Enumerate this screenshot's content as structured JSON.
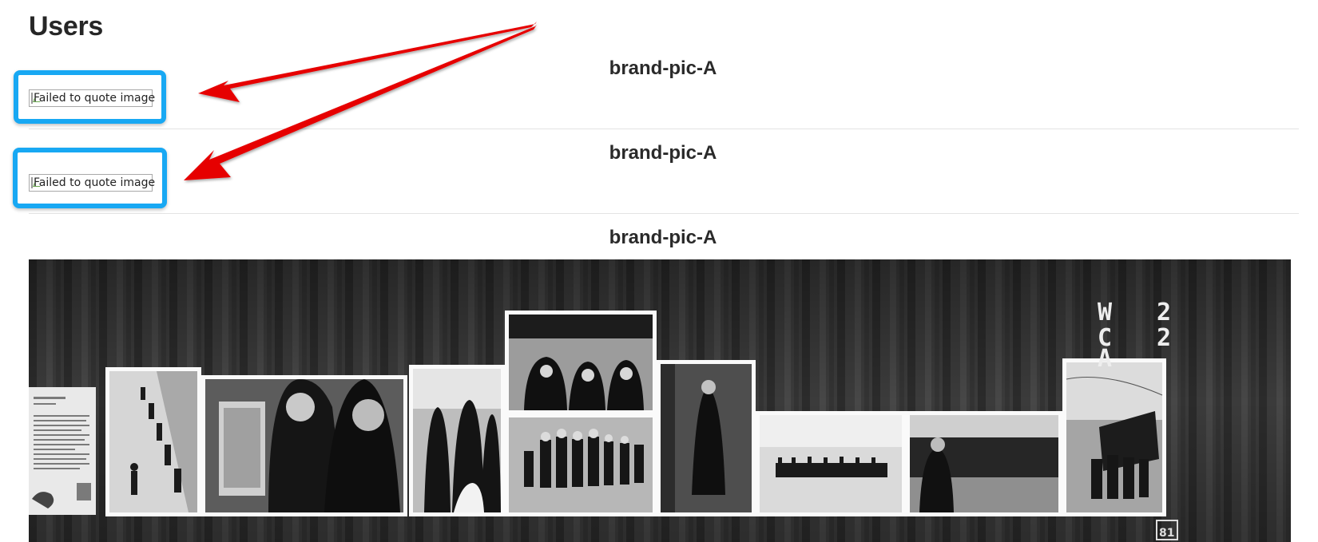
{
  "page": {
    "title": "Users"
  },
  "rows": [
    {
      "title": "brand-pic-A",
      "image_alt": "Failed to quote image",
      "image_state": "broken"
    },
    {
      "title": "brand-pic-A",
      "image_alt": "Failed to quote image",
      "image_state": "broken"
    },
    {
      "title": "brand-pic-A",
      "image_state": "loaded",
      "image_content": "black-and-white photograph series mounted on a shipping container"
    }
  ],
  "container_marking": {
    "left_column": "WCA",
    "right_column": "22",
    "plate": "81"
  },
  "colors": {
    "highlight": "#18a8f3",
    "arrow": "#e60000",
    "divider": "#e3e3e3"
  },
  "icons": {
    "broken_image": "broken-image-icon",
    "annotation": "arrow-icon"
  }
}
